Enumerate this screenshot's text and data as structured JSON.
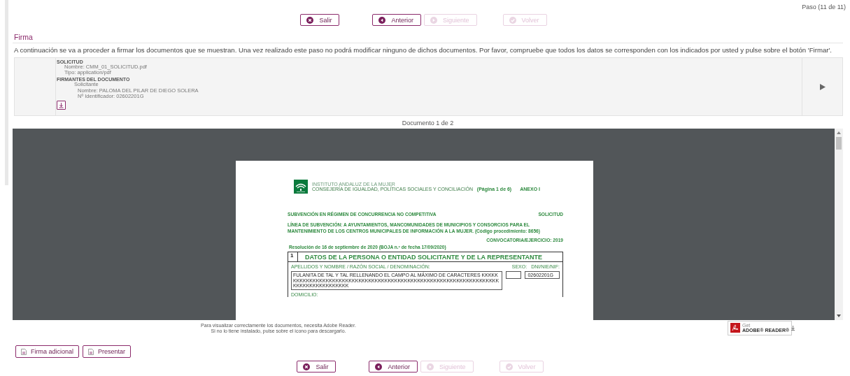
{
  "page_step": "Paso (11 de 11)",
  "nav_top": [
    {
      "label": "Salir",
      "kind": "close",
      "disabled": false
    },
    {
      "label": "Anterior",
      "kind": "prev",
      "disabled": false
    },
    {
      "label": "Siguiente",
      "kind": "next",
      "disabled": true
    },
    {
      "label": "Volver",
      "kind": "check",
      "disabled": true
    }
  ],
  "section_title": "Firma",
  "instructions": "A continuación se va a proceder a firmar los documentos que se muestran. Una vez realizado este paso no podrá modificar ninguno de dichos documentos. Por favor, compruebe que todos los datos se corresponden con los indicados por usted y pulse sobre el botón 'Firmar'.",
  "document": {
    "title": "SOLICITUD",
    "file_name": "Nombre: CMM_01_SOLICITUD.pdf",
    "file_type": "Tipo: application/pdf",
    "signers_heading": "FIRMANTES DEL DOCUMENTO",
    "signers": [
      {
        "role": "Solicitante",
        "name": "Nombre: PALOMA DEL PILAR DE DIEGO SOLERA",
        "identifier": "Nº Identificador: 02602201G"
      }
    ]
  },
  "document_counter": "Documento 1 de 2",
  "pdf_page": {
    "org_line_1": "INSTITUTO ANDALUZ DE LA MUJER",
    "org_line_2": "CONSEJERÍA DE IGUALDAD, POLÍTICAS SOCIALES Y CONCILIACIÓN",
    "page_label": "(Página 1 de 6)",
    "annex": "ANEXO I",
    "subsidy_type": "SUBVENCIÓN EN RÉGIMEN DE CONCURRENCIA NO COMPETITIVA",
    "form_kind": "SOLICITUD",
    "subsidy_line": "LÍNEA DE SUBVENCIÓN: A AYUNTAMIENTOS, MANCOMUNIDADES DE MUNICIPIOS Y CONSORCIOS PARA EL MANTENIMIENTO DE LOS CENTROS MUNICIPALES DE INFORMACIÓN A LA MUJER. (Código procedimiento: 8656)",
    "call": "CONVOCATORIA/EJERCICIO:  2019",
    "resolution": "Resolución de 16 de septiembre de 2020 (BOJA n.º   de fecha  17/09/2020)",
    "section_number": "1",
    "section_title": "DATOS DE LA PERSONA O ENTIDAD SOLICITANTE Y DE LA REPRESENTANTE",
    "name_label": "APELLIDOS Y NOMBRE / RAZÓN SOCIAL / DENOMINACIÓN:",
    "sex_label": "SEXO:",
    "id_label": "DNI/NIE/NIF:",
    "name_value": "FULANITA DE TAL Y TAL RELLENANDO EL CAMPO AL MÁXIMO DE CARACTERES KKKKKKKKKKKKKKKKKKKKKKKKKKKKKKKKKKKKKKKKKKKKKKKKKKKKKKKKKKKKKKKKKKKKKKKKKKKKKKKKKKKKK",
    "id_value": "02602201G",
    "next_label": "DOMICILIO:"
  },
  "adobe_notice": [
    "Para visualizar correctamente los documentos, necesita Adobe Reader.",
    "Si no lo tiene instalado, pulse sobre el icono para descargarlo."
  ],
  "adobe_badge": {
    "line_1": "Get",
    "line_2": "ADOBE® READER®"
  },
  "actions": [
    {
      "label": "Firma adicional"
    },
    {
      "label": "Presentar"
    }
  ],
  "nav_bottom": [
    {
      "label": "Salir",
      "kind": "close",
      "disabled": false
    },
    {
      "label": "Anterior",
      "kind": "prev",
      "disabled": false
    },
    {
      "label": "Siguiente",
      "kind": "next",
      "disabled": true
    },
    {
      "label": "Volver",
      "kind": "check",
      "disabled": true
    }
  ]
}
